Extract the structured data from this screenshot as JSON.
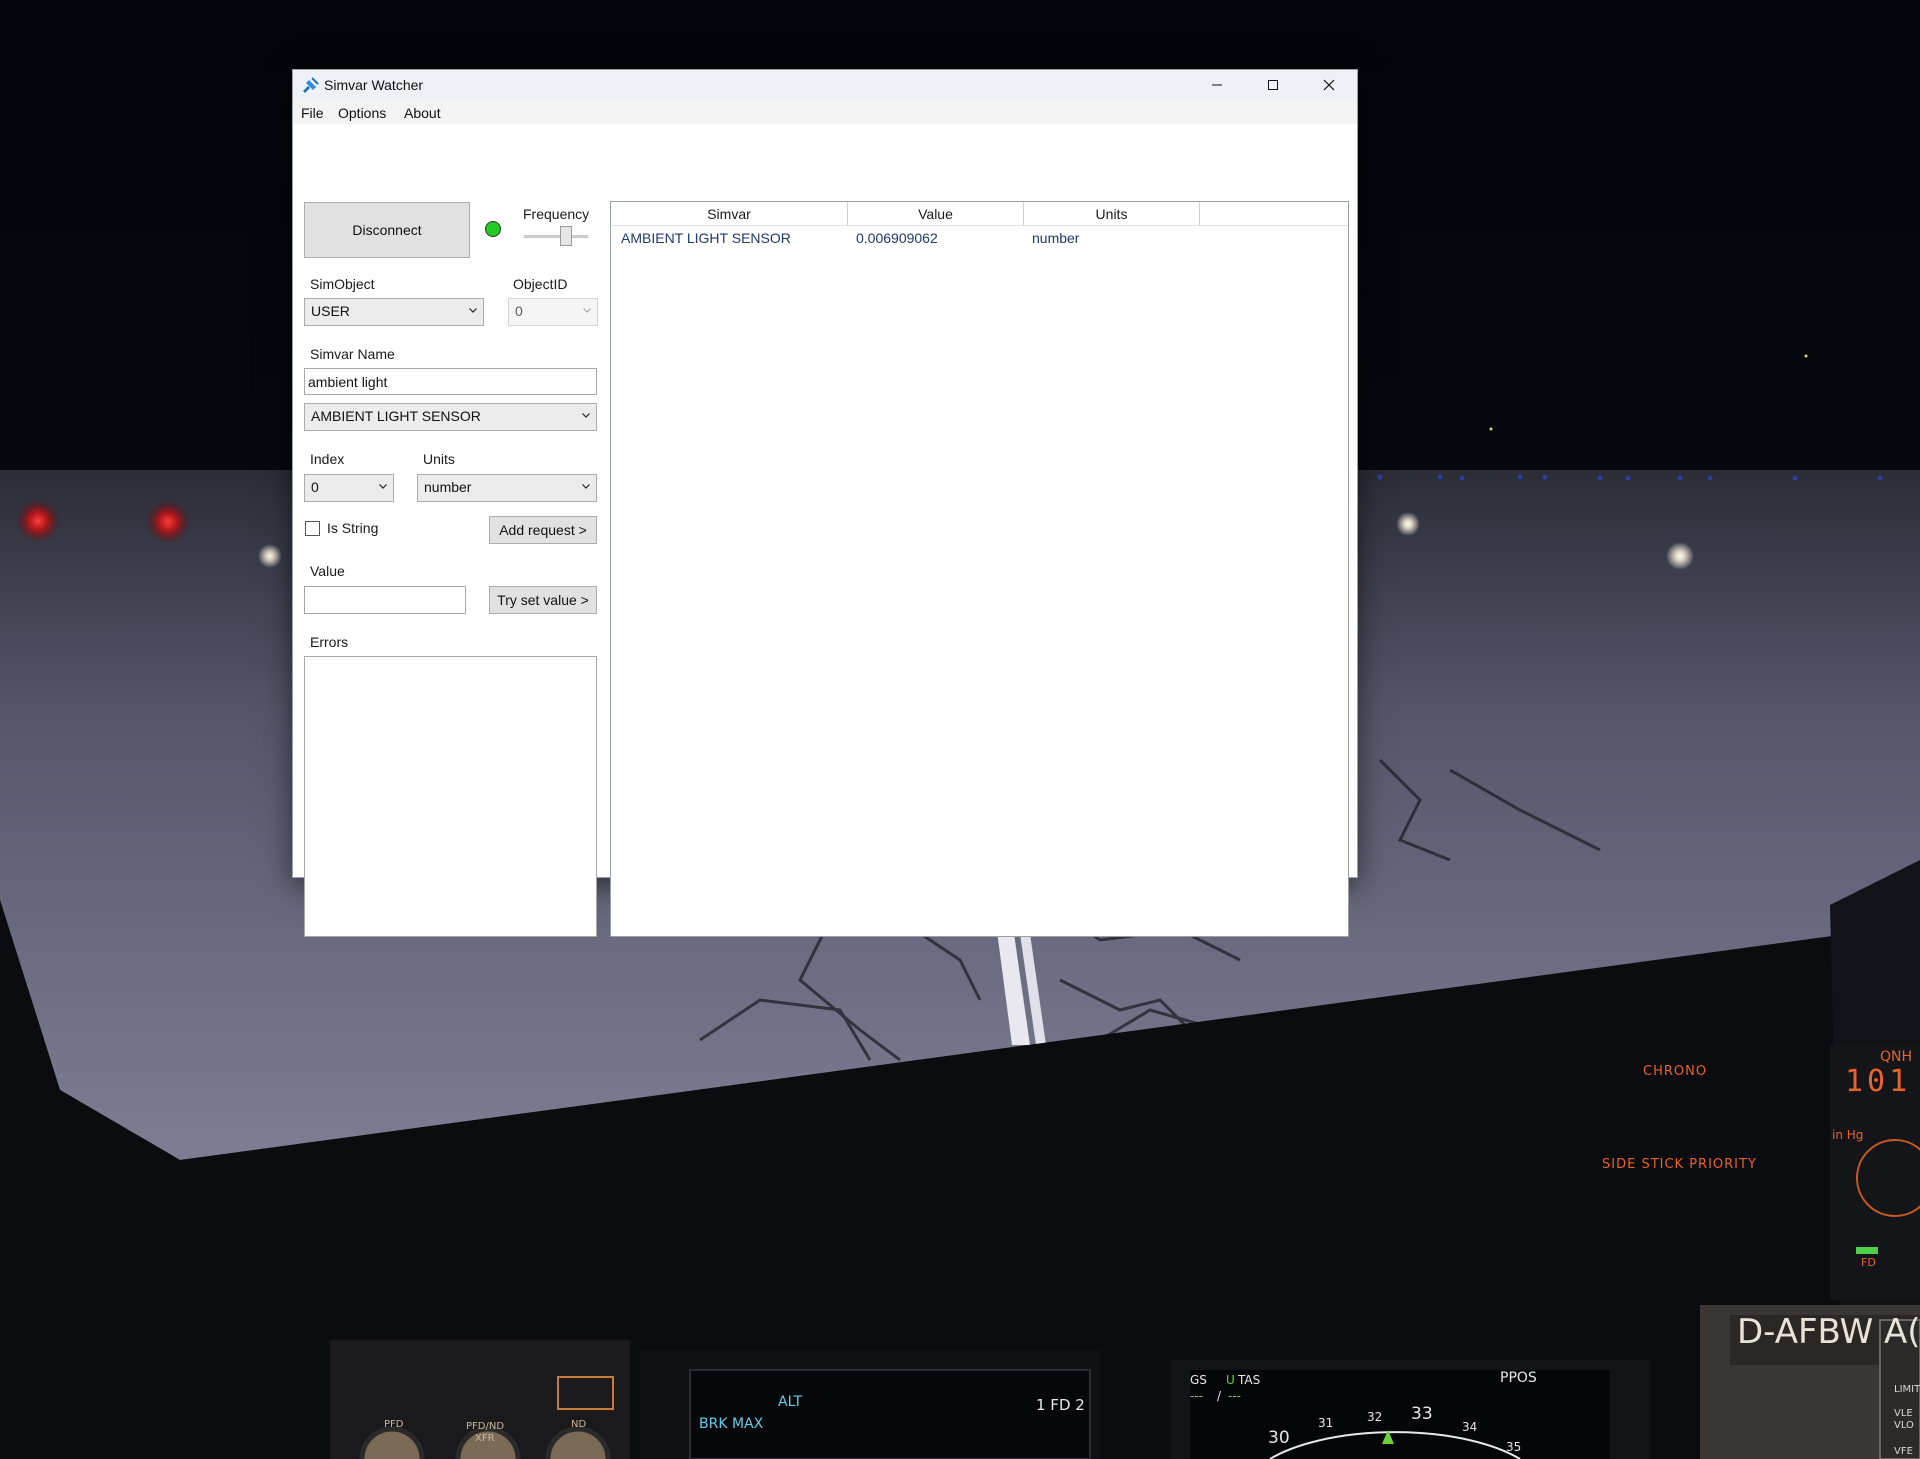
{
  "window": {
    "title": "Simvar Watcher",
    "controls": {
      "minimize": "minimize-icon",
      "maximize": "maximize-icon",
      "close": "close-icon"
    }
  },
  "menu": [
    "File",
    "Options",
    "About"
  ],
  "connection": {
    "button_label": "Disconnect",
    "status_color": "#22cc22",
    "frequency_label": "Frequency",
    "frequency_slider": 0.7
  },
  "simobject": {
    "label": "SimObject",
    "selected": "USER"
  },
  "objectid": {
    "label": "ObjectID",
    "selected": "0"
  },
  "simvar_name": {
    "label": "Simvar Name",
    "input_value": "ambient light",
    "selected": "AMBIENT LIGHT SENSOR"
  },
  "index": {
    "label": "Index",
    "selected": "0"
  },
  "units": {
    "label": "Units",
    "selected": "number"
  },
  "is_string": {
    "label": "Is String",
    "checked": false
  },
  "add_request_label": "Add request >",
  "value": {
    "label": "Value",
    "input_value": ""
  },
  "try_set_label": "Try set value >",
  "errors": {
    "label": "Errors",
    "content": ""
  },
  "table": {
    "columns": [
      "Simvar",
      "Value",
      "Units"
    ],
    "rows": [
      {
        "simvar": "AMBIENT LIGHT SENSOR",
        "value": "0.006909062",
        "units": "number"
      }
    ]
  },
  "cockpit": {
    "chrono": "CHRONO",
    "qnh": "QNH",
    "qnh_digits": "101",
    "in_hg": "in Hg",
    "side_stick": "SIDE STICK PRIORITY",
    "fd": "FD",
    "registration": "D-AFBW",
    "reg_suffix": "A(",
    "pfd_label": "PFD",
    "pfdnd_label": "PFD/ND",
    "xfr_label": "XFR",
    "nd_label": "ND",
    "fma_alt": "ALT",
    "fma_brk": "BRK MAX",
    "fma_fd": "1 FD 2",
    "nd_gs": "GS",
    "nd_u": "U",
    "nd_tas": "TAS",
    "nd_gs_val": "---",
    "nd_sep": "/",
    "nd_tas_val": "---",
    "nd_mode": "PPOS",
    "compass": [
      "30",
      "31",
      "32",
      "33",
      "34",
      "35"
    ],
    "limit_label": "LIMIT",
    "vle_label": "VLE",
    "vlo_label": "VLO",
    "vfe_label": "VFE"
  },
  "colors": {
    "accent_blue": "#1e73be",
    "status_green": "#22cc22",
    "cockpit_orange": "#e8622a",
    "fma_cyan": "#5fd0e8"
  }
}
